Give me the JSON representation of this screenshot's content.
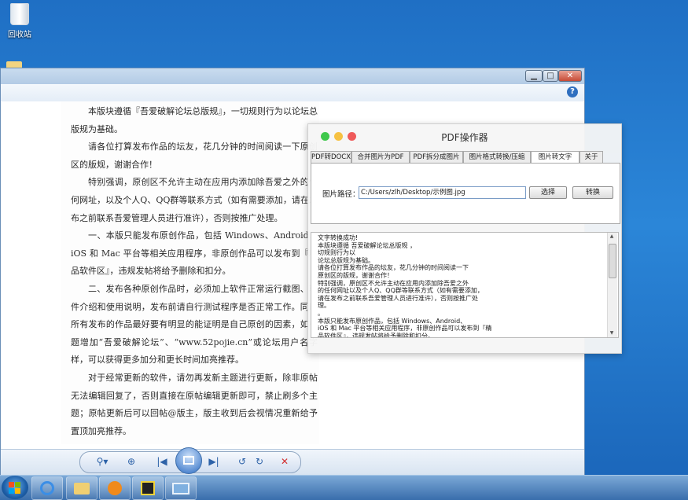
{
  "desktop": {
    "recycle_bin_label": "回收站"
  },
  "viewer": {
    "help_label": "?",
    "window_buttons": {
      "minimize": "▁",
      "maximize": "□",
      "close": "✕"
    },
    "document_paragraphs": [
      "本版块遵循『吾爱破解论坛总版规』，一切规则行为以论坛总版规为基础。",
      "请各位打算发布作品的坛友，花几分钟的时间阅读一下原创区的版规，谢谢合作！",
      "特别强调，原创区不允许主动在应用内添加除吾爱之外的任何网址，以及个人Q、QQ群等联系方式（如有需要添加，请在发布之前联系吾爱管理人员进行准许），否则按推广处理。",
      "一、本版只能发布原创作品，包括 Windows、Android、iOS 和 Mac 平台等相关应用程序，非原创作品可以发布到『精品软件区』，违规发帖将给予删除和扣分。",
      "二、发布各种原创作品时，必须加上软件正常运行截图、软件介绍和使用说明，发布前请自行测试程序是否正常工作。同时所有发布的作品最好要有明显的能证明是自己原创的因素，如标题增加“吾爱破解论坛”、“www.52pojie.cn”或论坛用户名字样，可以获得更多加分和更长时间加亮推荐。",
      "对于经常更新的软件，请勿再发新主题进行更新，除非原帖无法编辑回复了，否则直接在原帖编辑更新即可，禁止刷多个主题；原帖更新后可以回帖@版主，版主收到后会视情况重新给予置顶加亮推荐。"
    ],
    "toolbar": {
      "zoom": "⚲▾",
      "fit": "⊕",
      "prev": "|◀",
      "next": "▶|",
      "rotate_ccw": "↺",
      "rotate_cw": "↻",
      "delete": "✕"
    }
  },
  "pdf_tool": {
    "title": "PDF操作器",
    "traffic_light_colors": [
      "#3fc84c",
      "#f6c142",
      "#ef5a5a"
    ],
    "tabs": [
      {
        "label": "PDF转DOCX",
        "active": false
      },
      {
        "label": "合并图片为PDF",
        "active": false
      },
      {
        "label": "PDF拆分成图片",
        "active": false
      },
      {
        "label": "图片格式转换/压缩",
        "active": false
      },
      {
        "label": "图片转文字",
        "active": true
      },
      {
        "label": "关于",
        "active": false
      }
    ],
    "path_label": "图片路径：",
    "path_value": "C:/Users/zlh/Desktop/示例图.jpg",
    "select_button": "选择",
    "convert_button": "转换",
    "output_text": "文字转换成功!\n本版块遵循 吾爱破解论坛总版规 ，\n切规则行为以\n论坛总版规为基础。\n请各位打算发布作品的坛友，花几分钟的时间阅读一下\n原创区的版规，谢谢合作！\n特别强调，原创区不允许主动在应用内添加除吾爱之外\n的任何网址以及个人Q、QQ群等联系方式（如有需要添加，\n请在发布之前联系吾爱管理人员进行准许），否则按推广处\n理。\n。\n本版只能发布原创作品，包括 Windows、Android、\niOS 和 Mac 平台等相关应用程序，非原创作品可以发布到『精\n品软件区』，违规发帖将给予删除和扣分。"
  },
  "taskbar": {
    "items": [
      "ie",
      "explorer",
      "media-player",
      "pdf-tool",
      "photo-viewer"
    ]
  }
}
